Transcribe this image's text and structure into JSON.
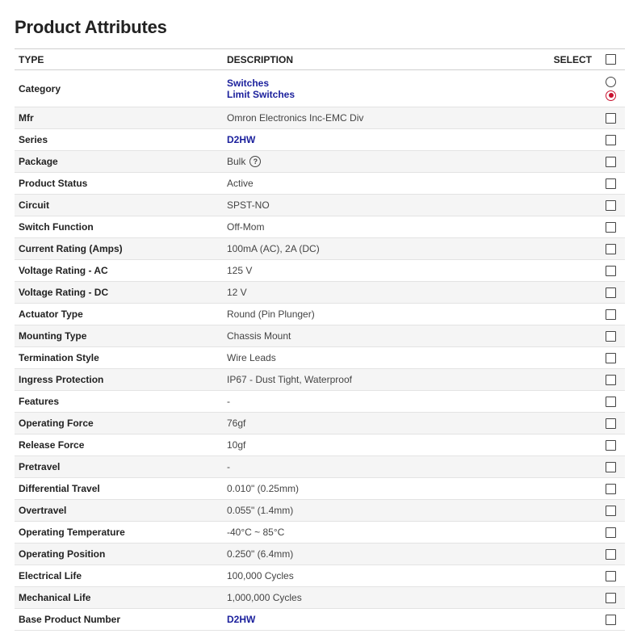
{
  "title": "Product Attributes",
  "columns": {
    "type": "TYPE",
    "description": "DESCRIPTION",
    "select": "SELECT"
  },
  "category": {
    "type": "Category",
    "values": [
      "Switches",
      "Limit Switches"
    ]
  },
  "rows": [
    {
      "type": "Mfr",
      "desc": "Omron Electronics Inc-EMC Div"
    },
    {
      "type": "Series",
      "desc": "D2HW"
    },
    {
      "type": "Package",
      "desc": "Bulk"
    },
    {
      "type": "Product Status",
      "desc": "Active"
    },
    {
      "type": "Circuit",
      "desc": "SPST-NO"
    },
    {
      "type": "Switch Function",
      "desc": "Off-Mom"
    },
    {
      "type": "Current Rating (Amps)",
      "desc": "100mA (AC), 2A (DC)"
    },
    {
      "type": "Voltage Rating - AC",
      "desc": "125 V"
    },
    {
      "type": "Voltage Rating - DC",
      "desc": "12 V"
    },
    {
      "type": "Actuator Type",
      "desc": "Round (Pin Plunger)"
    },
    {
      "type": "Mounting Type",
      "desc": "Chassis Mount"
    },
    {
      "type": "Termination Style",
      "desc": "Wire Leads"
    },
    {
      "type": "Ingress Protection",
      "desc": "IP67 - Dust Tight, Waterproof"
    },
    {
      "type": "Features",
      "desc": "-"
    },
    {
      "type": "Operating Force",
      "desc": "76gf"
    },
    {
      "type": "Release Force",
      "desc": "10gf"
    },
    {
      "type": "Pretravel",
      "desc": "-"
    },
    {
      "type": "Differential Travel",
      "desc": "0.010\" (0.25mm)"
    },
    {
      "type": "Overtravel",
      "desc": "0.055\" (1.4mm)"
    },
    {
      "type": "Operating Temperature",
      "desc": "-40°C ~ 85°C"
    },
    {
      "type": "Operating Position",
      "desc": "0.250\" (6.4mm)"
    },
    {
      "type": "Electrical Life",
      "desc": "100,000 Cycles"
    },
    {
      "type": "Mechanical Life",
      "desc": "1,000,000 Cycles"
    },
    {
      "type": "Base Product Number",
      "desc": "D2HW"
    }
  ],
  "help_icon": "question-circle-icon",
  "colors": {
    "link": "#1a1f9c",
    "radio_selected": "#c8102e",
    "row_alt": "#f5f5f5"
  }
}
